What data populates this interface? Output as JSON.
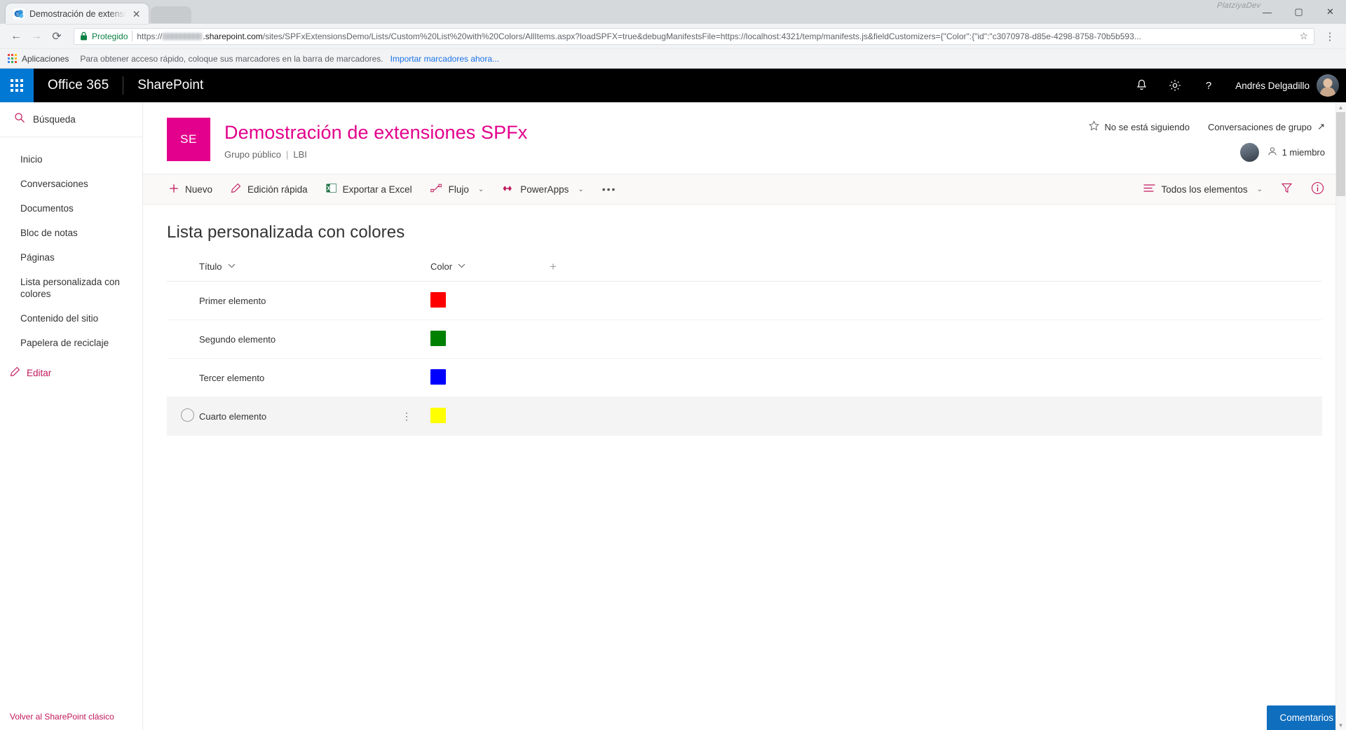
{
  "browser": {
    "tab": {
      "title": "Demostración de extensi",
      "favicon_name": "sharepoint-favicon",
      "close_label": "✕"
    },
    "new_tab_label": "+",
    "window_controls": {
      "minimize": "—",
      "maximize": "▢",
      "close": "✕"
    },
    "watermark": "PlatziyaDev",
    "nav": {
      "back": "←",
      "forward": "→",
      "reload": "⟳"
    },
    "omnibox": {
      "secure_label": "Protegido",
      "url_prefix": "https://",
      "url_host": ".sharepoint.com",
      "url_path": "/sites/SPFxExtensionsDemo/Lists/Custom%20List%20with%20Colors/AllItems.aspx?loadSPFX=true&debugManifestsFile=https://localhost:4321/temp/manifests.js&fieldCustomizers={\"Color\":{\"id\":\"c3070978-d85e-4298-8758-70b5b593...",
      "star": "☆",
      "menu": "⋮"
    },
    "bookmarks": {
      "apps_label": "Aplicaciones",
      "hint": "Para obtener acceso rápido, coloque sus marcadores en la barra de marcadores.",
      "import_link": "Importar marcadores ahora..."
    }
  },
  "suitebar": {
    "waffle_name": "app-launcher-icon",
    "office_brand": "Office 365",
    "sharepoint_brand": "SharePoint",
    "icons": {
      "notifications": "bell-icon",
      "settings": "gear-icon",
      "help": "help-icon"
    },
    "user_name": "Andrés Delgadillo"
  },
  "sidebar": {
    "search_label": "Búsqueda",
    "items": [
      {
        "label": "Inicio",
        "selected": false
      },
      {
        "label": "Conversaciones",
        "selected": false
      },
      {
        "label": "Documentos",
        "selected": false
      },
      {
        "label": "Bloc de notas",
        "selected": false
      },
      {
        "label": "Páginas",
        "selected": false
      },
      {
        "label": "Lista personalizada con colores",
        "selected": true
      },
      {
        "label": "Contenido del sitio",
        "selected": false
      },
      {
        "label": "Papelera de reciclaje",
        "selected": false
      }
    ],
    "edit_label": "Editar",
    "classic_link": "Volver al SharePoint clásico"
  },
  "site": {
    "logo_initials": "SE",
    "logo_color": "#e3008c",
    "title": "Demostración de extensiones SPFx",
    "title_color": "#e3008c",
    "privacy": "Grupo público",
    "separator": "|",
    "classification": "LBI",
    "follow_label": "No se está siguiendo",
    "group_conversations_label": "Conversaciones de grupo",
    "external_link_glyph": "↗",
    "members_label": "1 miembro"
  },
  "commandbar": {
    "items": [
      {
        "label": "Nuevo",
        "icon": "plus-icon",
        "has_chevron": false
      },
      {
        "label": "Edición rápida",
        "icon": "pencil-icon",
        "has_chevron": false
      },
      {
        "label": "Exportar a Excel",
        "icon": "excel-icon",
        "has_chevron": false
      },
      {
        "label": "Flujo",
        "icon": "flow-icon",
        "has_chevron": true
      },
      {
        "label": "PowerApps",
        "icon": "powerapps-icon",
        "has_chevron": true
      }
    ],
    "overflow_label": "•••",
    "view_label": "Todos los elementos",
    "view_chevron": "⌄",
    "filter_icon": "filter-icon",
    "info_icon": "info-icon"
  },
  "list": {
    "title": "Lista personalizada con colores",
    "columns": [
      {
        "label": "Título",
        "sortable": true
      },
      {
        "label": "Color",
        "sortable": true
      }
    ],
    "add_column_glyph": "+",
    "rows": [
      {
        "title": "Primer elemento",
        "color_name": "red",
        "color_hex": "#ff0000",
        "selected": false
      },
      {
        "title": "Segundo elemento",
        "color_name": "green",
        "color_hex": "#008000",
        "selected": false
      },
      {
        "title": "Tercer elemento",
        "color_name": "blue",
        "color_hex": "#0000ff",
        "selected": false
      },
      {
        "title": "Cuarto elemento",
        "color_name": "yellow",
        "color_hex": "#ffff00",
        "selected": true
      }
    ],
    "row_ellipsis_glyph": "⋮"
  },
  "feedback": {
    "label": "Comentarios"
  }
}
